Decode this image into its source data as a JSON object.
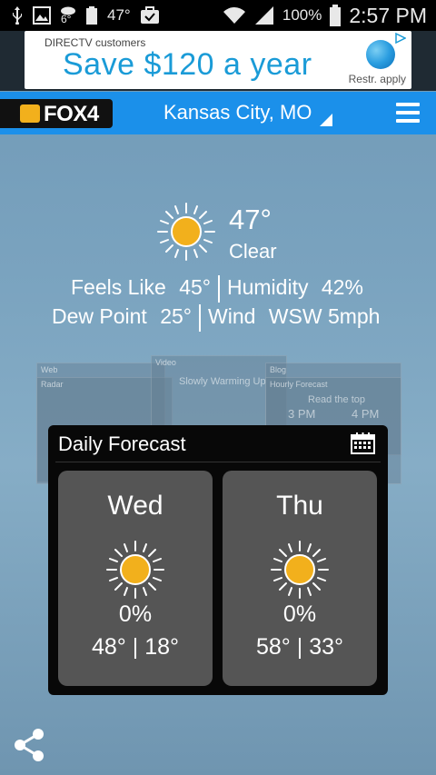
{
  "status_bar": {
    "temp": "47°",
    "battery_percent": "100%",
    "time": "2:57 PM",
    "notif_small": "6°",
    "icons": [
      "usb-icon",
      "image-icon",
      "weather-icon",
      "battery-small-icon",
      "briefcase-icon",
      "wifi-icon",
      "signal-icon",
      "battery-icon"
    ]
  },
  "ad": {
    "small_text": "DIRECTV customers",
    "headline": "Save $120 a year",
    "disclaimer": "Restr. apply"
  },
  "header": {
    "logo_text": "FOX4",
    "city": "Kansas City, MO",
    "accent_color": "#1b90ea"
  },
  "current": {
    "temp": "47°",
    "condition": "Clear",
    "feels_like_label": "Feels Like",
    "feels_like": "45°",
    "humidity_label": "Humidity",
    "humidity": "42%",
    "dew_point_label": "Dew Point",
    "dew_point": "25°",
    "wind_label": "Wind",
    "wind": "WSW 5mph"
  },
  "background_cards": {
    "web": "Web",
    "video": "Video",
    "video_text": "Slowly Warming Up",
    "blog": "Blog",
    "radar": "Radar",
    "hourly": "Hourly Forecast",
    "hourly_text": "Read the top",
    "hour_a": "3 PM",
    "hour_b": "4 PM"
  },
  "daily": {
    "title": "Daily Forecast",
    "days": [
      {
        "name": "Wed",
        "precip": "0%",
        "hilo": "48° | 18°"
      },
      {
        "name": "Thu",
        "precip": "0%",
        "hilo": "58° | 33°"
      }
    ]
  }
}
